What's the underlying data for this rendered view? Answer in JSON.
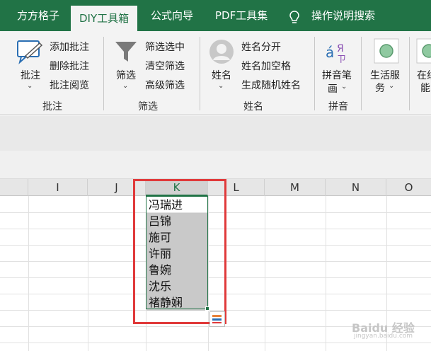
{
  "tabs": [
    {
      "label": "方方格子"
    },
    {
      "label": "DIY工具箱"
    },
    {
      "label": "公式向导"
    },
    {
      "label": "PDF工具集"
    },
    {
      "label": "操作说明搜索"
    }
  ],
  "ribbon": {
    "comment_group": {
      "main_label": "批注",
      "items": [
        "添加批注",
        "删除批注",
        "批注阅览"
      ],
      "group_label": "批注"
    },
    "filter_group": {
      "main_label": "筛选",
      "items": [
        "筛选选中",
        "清空筛选",
        "高级筛选"
      ],
      "group_label": "筛选"
    },
    "name_group": {
      "main_label": "姓名",
      "items": [
        "姓名分开",
        "姓名加空格",
        "生成随机姓名"
      ],
      "group_label": "姓名"
    },
    "pinyin_group": {
      "main_label_1": "拼音笔",
      "main_label_2": "画",
      "group_label": "拼音"
    },
    "life_services": {
      "label_1": "生活服",
      "label_2": "务"
    },
    "online": {
      "label_1": "在线",
      "label_2": "能"
    }
  },
  "columns": [
    "I",
    "J",
    "K",
    "L",
    "M",
    "N",
    "O"
  ],
  "cells": [
    "冯瑞进",
    "吕锦",
    "施可",
    "许丽",
    "鲁婉",
    "沈乐",
    "褚静娴"
  ],
  "watermark": {
    "brand": "Baidu 经验",
    "url": "jingyan.baidu.com"
  },
  "colors": {
    "accent": "#217346",
    "highlight_box": "#e0393a"
  }
}
